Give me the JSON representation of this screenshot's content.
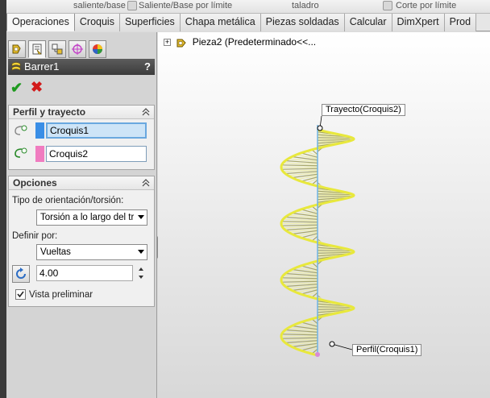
{
  "ribbon": {
    "items": [
      "saliente/base",
      "Saliente/Base por límite",
      "taladro",
      "Corte por límite"
    ]
  },
  "tabs": [
    "Operaciones",
    "Croquis",
    "Superficies",
    "Chapa metálica",
    "Piezas soldadas",
    "Calcular",
    "DimXpert",
    "Prod"
  ],
  "property_manager": {
    "title": "Barrer1",
    "help": "?",
    "ok_symbol": "✔",
    "cancel_symbol": "✖",
    "profile_path": {
      "title": "Perfil y trayecto",
      "profile_value": "Croquis1",
      "path_value": "Croquis2",
      "profile_color": "#3a8ee6",
      "path_color": "#f07cc0"
    },
    "options": {
      "title": "Opciones",
      "orientation_label": "Tipo de orientación/torsión:",
      "orientation_value": "Torsión a lo largo del tra",
      "define_label": "Definir por:",
      "define_value": "Vueltas",
      "turns_value": "4.00",
      "preview_label": "Vista preliminar",
      "preview_checked": true
    }
  },
  "graphics": {
    "tree_root": "Pieza2  (Predeterminado<<...",
    "callout_path": "Trayecto(Croquis2)",
    "callout_profile": "Perfil(Croquis1)",
    "accent": "#e8e83c"
  }
}
